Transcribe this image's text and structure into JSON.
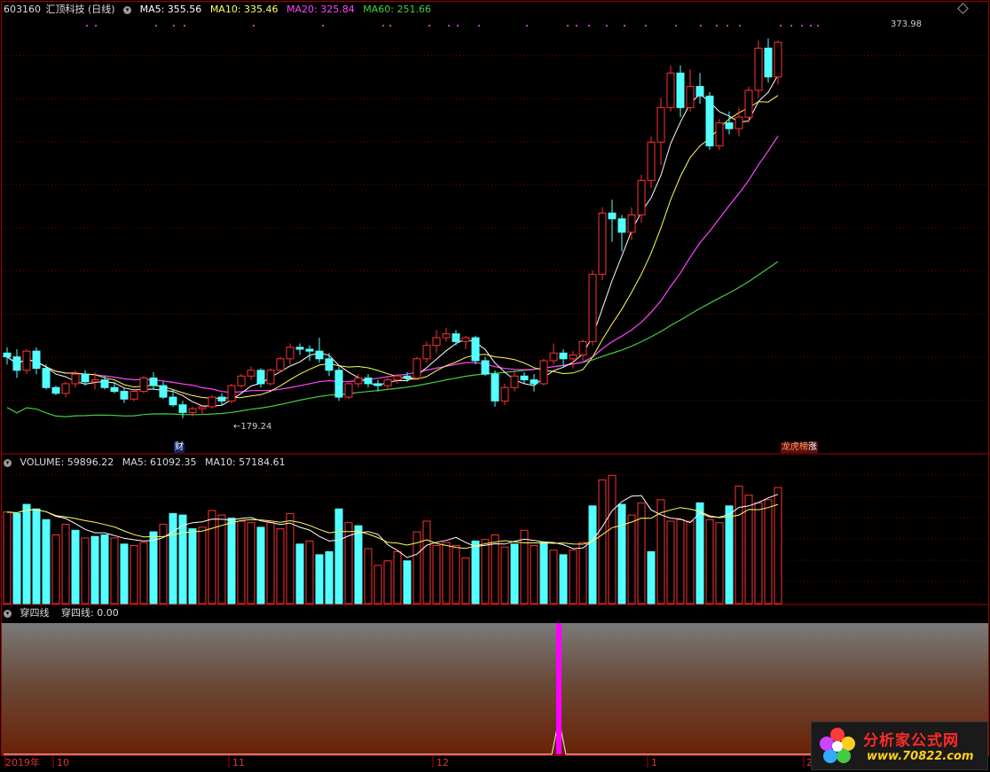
{
  "header": {
    "code": "603160",
    "name": "汇顶科技",
    "period": "(日线)",
    "ma5": "MA5: 355.56",
    "ma10": "MA10: 335.46",
    "ma20": "MA20: 325.84",
    "ma60": "MA60: 251.66"
  },
  "price_labels": {
    "high": "373.98",
    "low": "179.24"
  },
  "event_tags": {
    "cai": "财",
    "longhu": "龙虎榜",
    "zhang": "涨"
  },
  "volume_header": {
    "volume": "VOLUME: 59896.22",
    "ma5": "MA5: 61092.35",
    "ma10": "MA10: 57184.61"
  },
  "indicator_header": {
    "name": "穿四线",
    "value": "穿四线: 0.00"
  },
  "time_axis": [
    "2019年",
    "10",
    "11",
    "12",
    "1",
    "2"
  ],
  "colors": {
    "up": "#ff3232",
    "down": "#54ffff",
    "ma5": "#ffffff",
    "ma10": "#ffff5a",
    "ma20": "#ff44ff",
    "ma60": "#44cc44",
    "grid": "#7a0000",
    "signal": "#ff00ff"
  },
  "logo": {
    "title": "分析家公式网",
    "url": "www.70822.com"
  },
  "chart_data": {
    "type": "candlestick",
    "ohlc": [
      [
        212,
        215,
        206,
        210
      ],
      [
        210,
        214,
        199,
        203
      ],
      [
        203,
        214,
        201,
        213
      ],
      [
        213,
        215,
        201,
        204
      ],
      [
        204,
        206,
        193,
        194
      ],
      [
        194,
        195,
        190,
        191
      ],
      [
        191,
        197,
        189,
        196
      ],
      [
        196,
        203,
        194,
        201
      ],
      [
        201,
        203,
        195,
        197
      ],
      [
        197,
        202,
        193,
        198
      ],
      [
        198,
        200,
        193,
        194
      ],
      [
        194,
        197,
        191,
        192
      ],
      [
        192,
        194,
        186,
        188
      ],
      [
        188,
        193,
        187,
        192
      ],
      [
        192,
        200,
        191,
        199
      ],
      [
        199,
        202,
        193,
        195
      ],
      [
        195,
        197,
        188,
        189
      ],
      [
        189,
        193,
        184,
        185
      ],
      [
        185,
        187,
        178,
        181
      ],
      [
        181,
        184,
        179,
        183
      ],
      [
        183,
        185,
        180,
        184
      ],
      [
        184,
        190,
        183,
        189
      ],
      [
        189,
        191,
        185,
        187
      ],
      [
        187,
        196,
        186,
        195
      ],
      [
        195,
        201,
        194,
        200
      ],
      [
        200,
        205,
        198,
        203
      ],
      [
        203,
        204,
        194,
        196
      ],
      [
        196,
        204,
        195,
        203
      ],
      [
        203,
        210,
        202,
        209
      ],
      [
        209,
        217,
        206,
        215
      ],
      [
        215,
        217,
        211,
        214
      ],
      [
        214,
        216,
        208,
        213
      ],
      [
        213,
        220,
        207,
        209
      ],
      [
        209,
        212,
        200,
        203
      ],
      [
        203,
        205,
        187,
        189
      ],
      [
        189,
        197,
        188,
        196
      ],
      [
        196,
        201,
        194,
        199
      ],
      [
        199,
        201,
        194,
        196
      ],
      [
        196,
        198,
        192,
        195
      ],
      [
        195,
        199,
        193,
        198
      ],
      [
        198,
        201,
        196,
        200
      ],
      [
        200,
        202,
        197,
        199
      ],
      [
        199,
        210,
        198,
        209
      ],
      [
        209,
        218,
        207,
        216
      ],
      [
        216,
        224,
        212,
        220
      ],
      [
        220,
        225,
        218,
        222
      ],
      [
        222,
        224,
        216,
        218
      ],
      [
        218,
        221,
        214,
        220
      ],
      [
        220,
        221,
        206,
        208
      ],
      [
        208,
        210,
        200,
        201
      ],
      [
        201,
        203,
        184,
        187
      ],
      [
        187,
        196,
        185,
        194
      ],
      [
        194,
        203,
        192,
        200
      ],
      [
        200,
        202,
        196,
        198
      ],
      [
        198,
        201,
        192,
        196
      ],
      [
        196,
        209,
        195,
        208
      ],
      [
        208,
        217,
        206,
        212
      ],
      [
        212,
        214,
        205,
        209
      ],
      [
        209,
        213,
        204,
        211
      ],
      [
        211,
        219,
        208,
        218
      ],
      [
        218,
        255,
        216,
        253
      ],
      [
        253,
        288,
        250,
        285
      ],
      [
        285,
        292,
        270,
        282
      ],
      [
        282,
        284,
        265,
        275
      ],
      [
        275,
        288,
        271,
        284
      ],
      [
        284,
        305,
        280,
        302
      ],
      [
        302,
        325,
        298,
        322
      ],
      [
        322,
        345,
        310,
        340
      ],
      [
        340,
        362,
        338,
        358
      ],
      [
        358,
        362,
        335,
        340
      ],
      [
        340,
        360,
        338,
        351
      ],
      [
        351,
        358,
        342,
        346
      ],
      [
        346,
        348,
        318,
        320
      ],
      [
        320,
        334,
        318,
        332
      ],
      [
        332,
        338,
        326,
        329
      ],
      [
        329,
        340,
        325,
        335
      ],
      [
        335,
        351,
        332,
        349
      ],
      [
        349,
        375,
        345,
        371
      ],
      [
        371,
        376,
        353,
        356
      ],
      [
        356,
        375,
        352,
        374
      ]
    ],
    "volume": [
      [
        1,
        60
      ],
      [
        0,
        59
      ],
      [
        0,
        65
      ],
      [
        0,
        62
      ],
      [
        0,
        55
      ],
      [
        1,
        45
      ],
      [
        1,
        52
      ],
      [
        0,
        48
      ],
      [
        1,
        43
      ],
      [
        0,
        44
      ],
      [
        0,
        45
      ],
      [
        1,
        43
      ],
      [
        0,
        39
      ],
      [
        1,
        38
      ],
      [
        1,
        40
      ],
      [
        0,
        47
      ],
      [
        1,
        52
      ],
      [
        0,
        59
      ],
      [
        0,
        58
      ],
      [
        0,
        49
      ],
      [
        1,
        50
      ],
      [
        1,
        61
      ],
      [
        1,
        58
      ],
      [
        0,
        56
      ],
      [
        1,
        54
      ],
      [
        1,
        53
      ],
      [
        0,
        50
      ],
      [
        1,
        53
      ],
      [
        1,
        49
      ],
      [
        1,
        59
      ],
      [
        0,
        39
      ],
      [
        1,
        41
      ],
      [
        0,
        32
      ],
      [
        0,
        34
      ],
      [
        0,
        62
      ],
      [
        1,
        53
      ],
      [
        0,
        51
      ],
      [
        1,
        36
      ],
      [
        1,
        25
      ],
      [
        1,
        28
      ],
      [
        1,
        34
      ],
      [
        0,
        28
      ],
      [
        1,
        47
      ],
      [
        1,
        54
      ],
      [
        1,
        38
      ],
      [
        1,
        40
      ],
      [
        1,
        38
      ],
      [
        1,
        30
      ],
      [
        0,
        41
      ],
      [
        1,
        42
      ],
      [
        1,
        45
      ],
      [
        1,
        37
      ],
      [
        0,
        39
      ],
      [
        1,
        48
      ],
      [
        1,
        38
      ],
      [
        0,
        40
      ],
      [
        1,
        35
      ],
      [
        0,
        32
      ],
      [
        1,
        35
      ],
      [
        1,
        40
      ],
      [
        0,
        64
      ],
      [
        1,
        81
      ],
      [
        1,
        84
      ],
      [
        0,
        65
      ],
      [
        1,
        58
      ],
      [
        1,
        66
      ],
      [
        0,
        34
      ],
      [
        1,
        68
      ],
      [
        1,
        54
      ],
      [
        1,
        55
      ],
      [
        1,
        54
      ],
      [
        0,
        66
      ],
      [
        1,
        55
      ],
      [
        1,
        53
      ],
      [
        0,
        64
      ],
      [
        1,
        77
      ],
      [
        1,
        71
      ],
      [
        1,
        66
      ],
      [
        1,
        68
      ],
      [
        1,
        76
      ]
    ],
    "signal_bar_index": 56,
    "price_range": [
      165,
      385
    ],
    "volume_max": 90
  }
}
